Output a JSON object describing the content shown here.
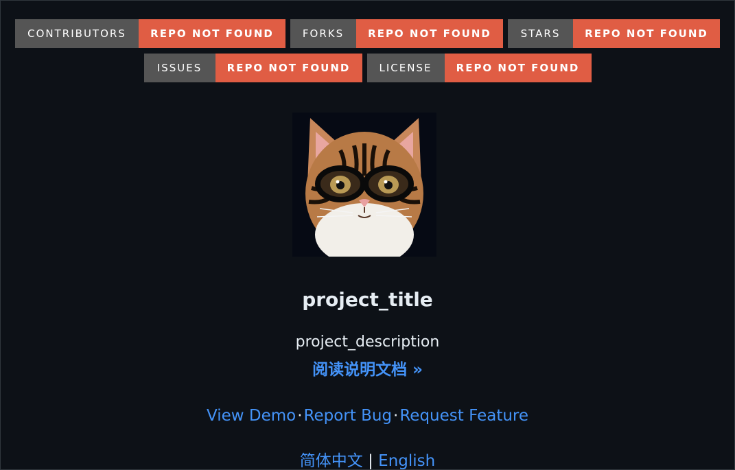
{
  "badges": {
    "contributors": {
      "label": "CONTRIBUTORS",
      "value": "REPO NOT FOUND"
    },
    "forks": {
      "label": "FORKS",
      "value": "REPO NOT FOUND"
    },
    "stars": {
      "label": "STARS",
      "value": "REPO NOT FOUND"
    },
    "issues": {
      "label": "ISSUES",
      "value": "REPO NOT FOUND"
    },
    "license": {
      "label": "LICENSE",
      "value": "REPO NOT FOUND"
    }
  },
  "colors": {
    "background": "#0d1117",
    "badge_label_bg": "#555555",
    "badge_value_bg": "#e05d44",
    "link": "#4493f8"
  },
  "project": {
    "title": "project_title",
    "description": "project_description",
    "docs_link": "阅读说明文档 »"
  },
  "links": {
    "view_demo": "View Demo",
    "report_bug": "Report Bug",
    "request_feature": "Request Feature",
    "separator": "·"
  },
  "languages": {
    "chinese": "简体中文",
    "separator": "|",
    "english": "English"
  }
}
